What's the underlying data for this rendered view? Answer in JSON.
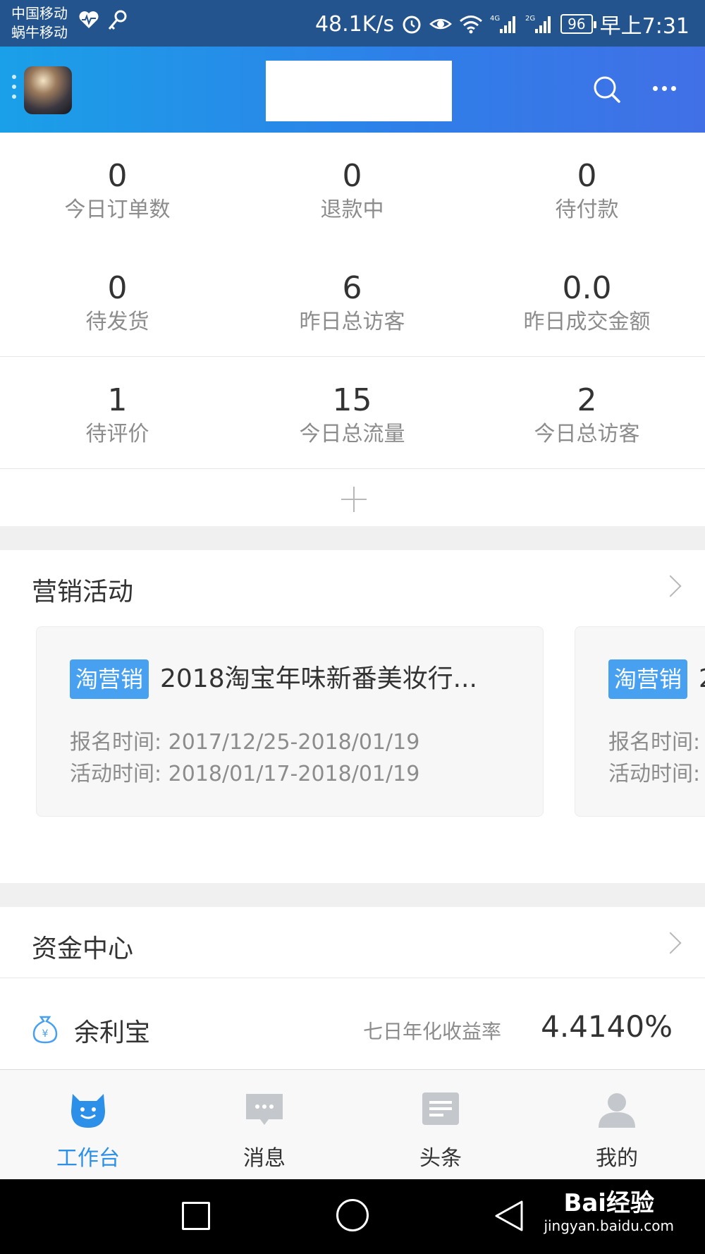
{
  "status_bar": {
    "carrier_1": "中国移动",
    "carrier_2": "蜗牛移动",
    "speed": "48.1K/s",
    "battery": "96",
    "time": "早上7:31"
  },
  "header": {
    "avatar": "store-avatar",
    "search_icon": "search-icon",
    "more_icon": "more-icon"
  },
  "stats": [
    [
      {
        "value": "0",
        "label": "今日订单数"
      },
      {
        "value": "0",
        "label": "退款中"
      },
      {
        "value": "0",
        "label": "待付款"
      }
    ],
    [
      {
        "value": "0",
        "label": "待发货"
      },
      {
        "value": "6",
        "label": "昨日总访客"
      },
      {
        "value": "0.0",
        "label": "昨日成交金额"
      }
    ],
    [
      {
        "value": "1",
        "label": "待评价"
      },
      {
        "value": "15",
        "label": "今日总流量"
      },
      {
        "value": "2",
        "label": "今日总访客"
      }
    ]
  ],
  "marketing": {
    "title": "营销活动",
    "cards": [
      {
        "badge": "淘营销",
        "title": "2018淘宝年味新番美妆行...",
        "signup": "报名时间: 2017/12/25-2018/01/19",
        "activity": "活动时间: 2018/01/17-2018/01/19"
      },
      {
        "badge": "淘营销",
        "title": "2",
        "signup": "报名时间:",
        "activity": "活动时间:"
      }
    ]
  },
  "finance": {
    "title": "资金中心",
    "yulibao_name": "余利宝",
    "yield_label": "七日年化收益率",
    "yield_value": "4.4140%"
  },
  "tabs": [
    {
      "label": "工作台",
      "icon": "workbench-icon",
      "active": true
    },
    {
      "label": "消息",
      "icon": "message-icon",
      "active": false
    },
    {
      "label": "头条",
      "icon": "headline-icon",
      "active": false
    },
    {
      "label": "我的",
      "icon": "profile-icon",
      "active": false
    }
  ],
  "watermark": {
    "line1": "Bai经验",
    "line2": "jingyan.baidu.com"
  },
  "colors": {
    "header_start": "#1aa0e8",
    "header_end": "#4170e6",
    "accent": "#2c8fe8",
    "badge": "#47a0f0"
  }
}
